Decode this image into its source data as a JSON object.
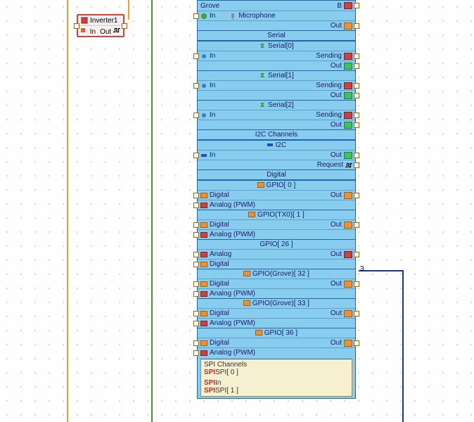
{
  "inverter": {
    "title": "Inverter1",
    "in_label": "In",
    "out_label": "Out"
  },
  "grove_header": "Grove",
  "grove": {
    "in": "In",
    "mic": "Microphone",
    "b": "B",
    "out": "Out"
  },
  "serial": {
    "header": "Serial",
    "items": [
      {
        "name": "Serial[0]",
        "in": "In",
        "sending": "Sending",
        "out": "Out"
      },
      {
        "name": "Serial[1]",
        "in": "In",
        "sending": "Sending",
        "out": "Out"
      },
      {
        "name": "Serial[2]",
        "in": "In",
        "sending": "Sending",
        "out": "Out"
      }
    ]
  },
  "i2c": {
    "header": "I2C Channels",
    "name": "I2C",
    "in": "In",
    "out": "Out",
    "request": "Request"
  },
  "digital": {
    "header": "Digital",
    "items": [
      {
        "name": "GPIO[ 0 ]",
        "p1": "Digital",
        "p2": "Analog (PWM)",
        "out": "Out"
      },
      {
        "name": "GPIO(TX0)[ 1 ]",
        "p1": "Digital",
        "p2": "Analog (PWM)",
        "out": "Out"
      },
      {
        "name": "GPIO[ 26 ]",
        "p1": "Analog",
        "p2": "Digital",
        "out": "Out"
      },
      {
        "name": "GPIO(Grove)[ 32 ]",
        "p1": "Digital",
        "p2": "Analog (PWM)",
        "out": "Out"
      },
      {
        "name": "GPIO(Grove)[ 33 ]",
        "p1": "Digital",
        "p2": "Analog (PWM)",
        "out": "Out"
      },
      {
        "name": "GPIO[ 36 ]",
        "p1": "Digital",
        "p2": "Analog (PWM)",
        "out": "Out"
      }
    ]
  },
  "spi": {
    "header": "SPI Channels",
    "items": [
      "SPI[ 0 ]",
      "SPI[ 1 ]"
    ],
    "in": "In"
  },
  "pin_label_3": "3"
}
